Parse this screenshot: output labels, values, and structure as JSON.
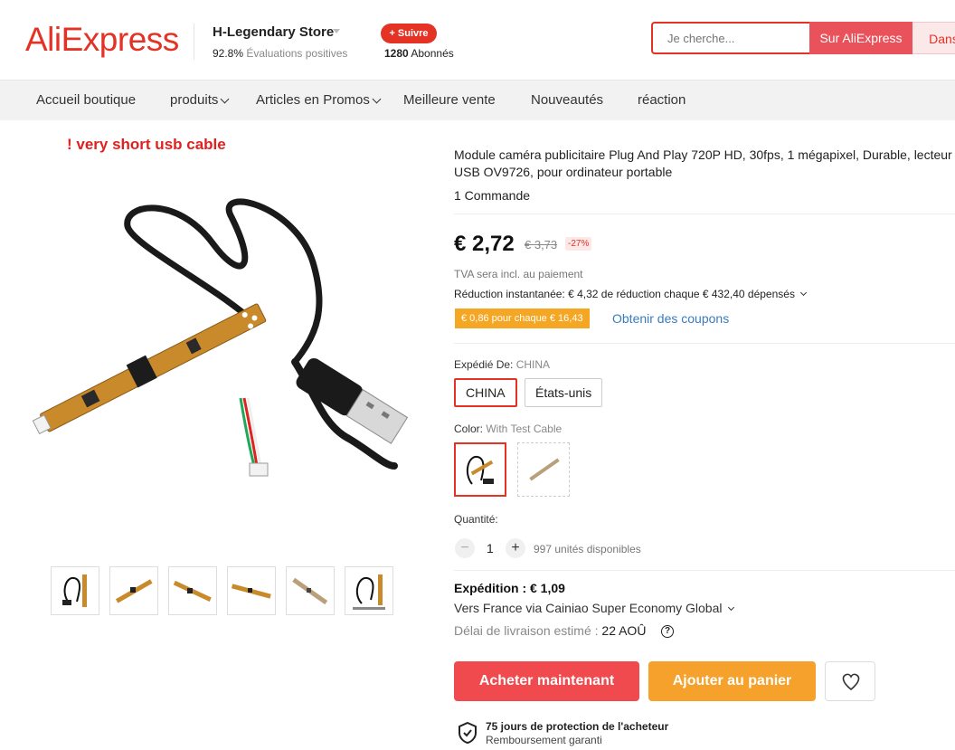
{
  "header": {
    "logo": "AliExpress",
    "store_name": "H-Legendary Store",
    "rating_value": "92.8%",
    "rating_label": "Évaluations positives",
    "follow_label": "+ Suivre",
    "followers_count": "1280",
    "followers_label": "Abonnés",
    "search_placeholder": "Je cherche...",
    "search_ali_label": "Sur AliExpress",
    "search_store_label": "Dans"
  },
  "nav": {
    "items": [
      "Accueil boutique",
      "produits",
      "Articles en Promos",
      "Meilleure vente",
      "Nouveautés",
      "réaction"
    ]
  },
  "gallery": {
    "warning": "! very short usb cable"
  },
  "product": {
    "title": "Module caméra publicitaire Plug And Play 720P HD, 30fps, 1 mégapixel, Durable, lecteur USB OV9726, pour ordinateur portable",
    "orders": "1 Commande",
    "price": "€ 2,72",
    "old_price": "€ 3,73",
    "discount": "-27%",
    "vat": "TVA sera incl. au paiement",
    "reduction": "Réduction instantanée: € 4,32 de réduction chaque € 432,40 dépensés",
    "coupon_tag": "€ 0,86 pour chaque € 16,43",
    "coupon_link": "Obtenir des coupons",
    "shipped_from_label": "Expédié De:",
    "shipped_from_value": "CHINA",
    "ship_options": [
      "CHINA",
      "États-unis"
    ],
    "color_label": "Color:",
    "color_value": "With Test Cable",
    "quantity_label": "Quantité:",
    "quantity": "1",
    "qty_minus": "−",
    "qty_plus": "+",
    "stock": "997 unités disponibles",
    "shipping_cost": "Expédition : € 1,09",
    "shipping_route": "Vers France via Cainiao Super Economy Global",
    "delivery_label": "Délai de livraison estimé :",
    "delivery_date": "22 AOÛ",
    "help": "?",
    "buy_label": "Acheter maintenant",
    "cart_label": "Ajouter au panier",
    "protection_title": "75 jours de protection de l'acheteur",
    "protection_sub": "Remboursement garanti"
  },
  "colors": {
    "brand": "#e43225",
    "buy": "#f04a4e",
    "cart": "#f6a12b",
    "coupon": "#f5a623",
    "link": "#3a7bbf"
  }
}
